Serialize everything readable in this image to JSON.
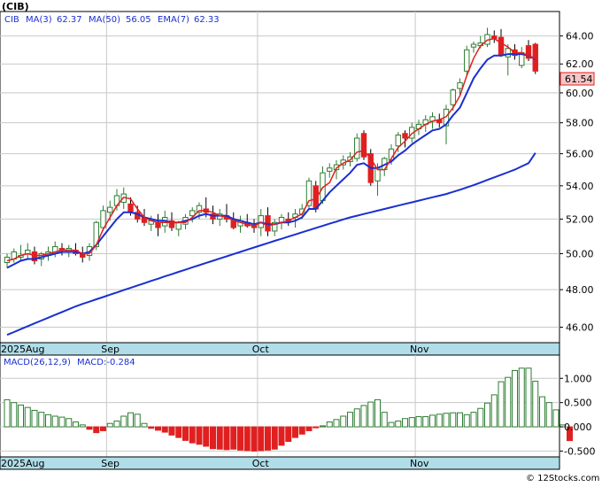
{
  "ticker_label": "(CIB)",
  "legend": {
    "symbol": "CIB",
    "ma3": "MA(3)",
    "ma3_value": "62.37",
    "ma50": "MA(50)",
    "ma50_value": "56.05",
    "ema7": "EMA(7)",
    "ema7_value": "62.33"
  },
  "last_price": "61.54",
  "macd_legend": {
    "label": "MACD(26,12,9)",
    "value_label": "MACD:-0.284"
  },
  "watermark": "© 12Stocks.com",
  "colors": {
    "up_candle": "#2e7d32",
    "down_candle": "#e02020",
    "ma_fast": "#e02020",
    "ma_mid": "#1a2fd0",
    "ma50": "#1a2fd0",
    "axis_band": "#b0dde8",
    "grid": "#c8c8c8",
    "macd_pos": "#2e7d32",
    "macd_neg": "#e02020"
  },
  "chart_data": [
    {
      "type": "candlestick",
      "x_labels": [
        {
          "label": "2025Aug",
          "index": 0
        },
        {
          "label": "Sep",
          "index": 15
        },
        {
          "label": "Oct",
          "index": 37
        },
        {
          "label": "Nov",
          "index": 60
        }
      ],
      "y_ticks": [
        "46.00",
        "48.00",
        "50.00",
        "52.00",
        "54.00",
        "56.00",
        "58.00",
        "60.00",
        "62.00",
        "64.00"
      ],
      "ylim": [
        45.2,
        65.8
      ],
      "y_scale": "log",
      "ohlc": [
        [
          49.5,
          50.0,
          49.2,
          49.8
        ],
        [
          49.7,
          50.3,
          49.5,
          50.1
        ],
        [
          49.8,
          50.5,
          49.6,
          49.9
        ],
        [
          50.0,
          50.6,
          49.7,
          50.2
        ],
        [
          50.1,
          50.4,
          49.4,
          49.6
        ],
        [
          49.7,
          50.1,
          49.3,
          50.0
        ],
        [
          49.9,
          50.4,
          49.6,
          50.1
        ],
        [
          50.0,
          50.7,
          49.8,
          50.4
        ],
        [
          50.3,
          50.6,
          49.9,
          50.2
        ],
        [
          50.1,
          50.5,
          49.8,
          50.3
        ],
        [
          50.2,
          50.6,
          49.9,
          50.0
        ],
        [
          50.0,
          50.4,
          49.5,
          49.8
        ],
        [
          49.9,
          50.6,
          49.6,
          50.4
        ],
        [
          50.4,
          51.9,
          50.2,
          51.8
        ],
        [
          51.5,
          52.8,
          51.3,
          52.5
        ],
        [
          52.4,
          53.1,
          51.9,
          52.7
        ],
        [
          52.8,
          53.8,
          52.5,
          53.4
        ],
        [
          53.0,
          53.9,
          52.6,
          53.5
        ],
        [
          52.9,
          53.3,
          52.2,
          52.4
        ],
        [
          52.4,
          52.8,
          51.8,
          52.0
        ],
        [
          52.1,
          52.6,
          51.6,
          51.8
        ],
        [
          51.7,
          52.2,
          51.3,
          51.9
        ],
        [
          51.8,
          52.3,
          51.0,
          51.5
        ],
        [
          51.6,
          52.5,
          51.2,
          52.1
        ],
        [
          51.9,
          52.4,
          51.3,
          51.5
        ],
        [
          51.4,
          51.9,
          51.0,
          51.8
        ],
        [
          51.7,
          52.3,
          51.4,
          52.1
        ],
        [
          52.2,
          52.7,
          51.8,
          52.5
        ],
        [
          52.4,
          53.0,
          52.0,
          52.8
        ],
        [
          52.6,
          53.3,
          52.1,
          52.4
        ],
        [
          52.3,
          52.8,
          51.7,
          52.0
        ],
        [
          52.0,
          52.6,
          51.6,
          52.3
        ],
        [
          52.2,
          52.9,
          51.8,
          52.0
        ],
        [
          51.9,
          52.4,
          51.4,
          51.5
        ],
        [
          51.6,
          52.2,
          51.2,
          51.9
        ],
        [
          51.8,
          52.3,
          51.5,
          51.6
        ],
        [
          51.6,
          52.0,
          51.2,
          51.5
        ],
        [
          51.5,
          52.6,
          51.0,
          52.2
        ],
        [
          52.2,
          52.7,
          51.0,
          51.3
        ],
        [
          51.3,
          52.0,
          51.0,
          51.8
        ],
        [
          51.8,
          52.3,
          51.4,
          52.1
        ],
        [
          52.0,
          52.4,
          51.6,
          51.9
        ],
        [
          52.1,
          52.6,
          51.5,
          52.3
        ],
        [
          52.3,
          52.9,
          52.0,
          52.6
        ],
        [
          52.8,
          54.5,
          52.6,
          54.3
        ],
        [
          54.0,
          54.3,
          52.4,
          52.6
        ],
        [
          53.1,
          55.2,
          52.9,
          54.8
        ],
        [
          54.9,
          55.4,
          54.5,
          55.1
        ],
        [
          55.0,
          55.6,
          54.4,
          55.3
        ],
        [
          55.3,
          55.9,
          55.0,
          55.6
        ],
        [
          55.5,
          56.1,
          55.2,
          55.8
        ],
        [
          55.7,
          57.3,
          55.5,
          57.0
        ],
        [
          57.3,
          57.5,
          55.6,
          55.8
        ],
        [
          56.0,
          56.3,
          54.0,
          54.2
        ],
        [
          54.3,
          55.4,
          53.4,
          55.1
        ],
        [
          55.0,
          55.8,
          54.6,
          55.7
        ],
        [
          55.6,
          56.6,
          55.3,
          56.3
        ],
        [
          56.5,
          57.4,
          56.1,
          57.2
        ],
        [
          57.3,
          57.5,
          56.4,
          57.0
        ],
        [
          57.0,
          58.0,
          56.7,
          57.7
        ],
        [
          57.6,
          58.2,
          57.2,
          57.9
        ],
        [
          57.9,
          58.5,
          57.4,
          58.2
        ],
        [
          58.1,
          58.7,
          57.6,
          58.4
        ],
        [
          58.2,
          58.6,
          57.7,
          58.0
        ],
        [
          57.8,
          59.2,
          56.6,
          58.9
        ],
        [
          59.2,
          60.3,
          58.8,
          60.2
        ],
        [
          60.3,
          61.0,
          59.8,
          60.7
        ],
        [
          61.5,
          63.3,
          61.2,
          63.0
        ],
        [
          63.2,
          63.6,
          62.8,
          63.4
        ],
        [
          63.3,
          64.0,
          63.1,
          63.5
        ],
        [
          63.4,
          64.6,
          63.2,
          64.1
        ],
        [
          64.0,
          64.4,
          63.5,
          63.8
        ],
        [
          63.9,
          64.5,
          62.5,
          62.6
        ],
        [
          62.5,
          63.4,
          61.2,
          63.1
        ],
        [
          63.0,
          63.4,
          62.3,
          62.6
        ],
        [
          61.9,
          63.2,
          61.7,
          62.8
        ],
        [
          63.3,
          63.7,
          62.2,
          62.4
        ],
        [
          63.4,
          63.5,
          61.3,
          61.5
        ]
      ],
      "ma3": [
        49.6,
        49.7,
        49.9,
        50.0,
        49.9,
        49.9,
        50.0,
        50.1,
        50.2,
        50.2,
        50.2,
        50.0,
        50.0,
        50.5,
        51.4,
        52.1,
        52.8,
        53.3,
        53.2,
        52.6,
        52.1,
        51.9,
        51.8,
        51.8,
        51.8,
        51.8,
        51.8,
        52.1,
        52.5,
        52.5,
        52.4,
        52.2,
        52.1,
        51.9,
        51.8,
        51.7,
        51.6,
        51.8,
        51.6,
        51.7,
        51.8,
        51.9,
        52.1,
        52.3,
        53.1,
        53.2,
        53.9,
        54.2,
        55.1,
        55.4,
        55.6,
        56.1,
        56.2,
        55.7,
        55.0,
        55.0,
        55.7,
        56.4,
        56.8,
        57.3,
        57.6,
        57.9,
        58.1,
        58.2,
        58.4,
        59.0,
        59.8,
        61.2,
        62.4,
        63.3,
        63.7,
        63.8,
        63.5,
        63.2,
        62.8,
        62.8,
        62.6,
        62.37
      ],
      "ema7": [
        49.2,
        49.4,
        49.6,
        49.7,
        49.7,
        49.8,
        49.9,
        50.0,
        50.1,
        50.1,
        50.1,
        50.0,
        50.1,
        50.5,
        51.0,
        51.5,
        52.0,
        52.4,
        52.4,
        52.3,
        52.1,
        52.0,
        51.9,
        51.9,
        51.8,
        51.8,
        51.9,
        52.0,
        52.2,
        52.3,
        52.2,
        52.2,
        52.2,
        52.0,
        51.9,
        51.8,
        51.7,
        51.8,
        51.7,
        51.7,
        51.8,
        51.8,
        51.9,
        52.1,
        52.6,
        52.6,
        53.1,
        53.6,
        54.0,
        54.4,
        54.8,
        55.3,
        55.4,
        55.1,
        55.1,
        55.3,
        55.5,
        55.9,
        56.2,
        56.6,
        56.9,
        57.2,
        57.5,
        57.6,
        57.9,
        58.5,
        59.0,
        60.0,
        61.0,
        61.7,
        62.3,
        62.6,
        62.6,
        62.7,
        62.7,
        62.7,
        62.6,
        62.33
      ],
      "ma50": [
        45.6,
        45.75,
        45.9,
        46.05,
        46.2,
        46.35,
        46.5,
        46.65,
        46.8,
        46.95,
        47.1,
        47.23,
        47.35,
        47.48,
        47.6,
        47.73,
        47.85,
        47.98,
        48.1,
        48.23,
        48.35,
        48.48,
        48.6,
        48.73,
        48.85,
        48.98,
        49.1,
        49.23,
        49.35,
        49.48,
        49.6,
        49.73,
        49.85,
        49.98,
        50.1,
        50.23,
        50.35,
        50.48,
        50.6,
        50.73,
        50.85,
        50.98,
        51.1,
        51.23,
        51.35,
        51.48,
        51.6,
        51.73,
        51.85,
        51.98,
        52.1,
        52.2,
        52.3,
        52.4,
        52.5,
        52.6,
        52.7,
        52.8,
        52.9,
        53.0,
        53.1,
        53.2,
        53.3,
        53.4,
        53.5,
        53.63,
        53.76,
        53.9,
        54.04,
        54.2,
        54.36,
        54.52,
        54.68,
        54.84,
        55.0,
        55.2,
        55.4,
        56.05
      ]
    },
    {
      "type": "bar",
      "title": "MACD(26,12,9)",
      "y_ticks": [
        "1.000",
        "0.500",
        "0.000",
        "-0.500"
      ],
      "ylim": [
        -0.62,
        1.48
      ],
      "values": [
        0.56,
        0.5,
        0.45,
        0.4,
        0.34,
        0.3,
        0.25,
        0.22,
        0.2,
        0.17,
        0.1,
        0.04,
        -0.05,
        -0.12,
        -0.08,
        0.07,
        0.12,
        0.22,
        0.29,
        0.26,
        0.07,
        -0.03,
        -0.07,
        -0.11,
        -0.17,
        -0.22,
        -0.28,
        -0.33,
        -0.36,
        -0.4,
        -0.45,
        -0.46,
        -0.47,
        -0.46,
        -0.48,
        -0.49,
        -0.5,
        -0.49,
        -0.48,
        -0.46,
        -0.38,
        -0.3,
        -0.22,
        -0.15,
        -0.08,
        -0.02,
        0.02,
        0.1,
        0.15,
        0.22,
        0.3,
        0.37,
        0.44,
        0.51,
        0.56,
        0.3,
        0.09,
        0.12,
        0.17,
        0.19,
        0.21,
        0.21,
        0.24,
        0.26,
        0.28,
        0.29,
        0.29,
        0.25,
        0.3,
        0.38,
        0.49,
        0.66,
        0.93,
        1.02,
        1.16,
        1.21,
        1.21,
        0.94,
        0.62,
        0.5,
        0.35,
        0.04,
        -0.284
      ]
    }
  ]
}
